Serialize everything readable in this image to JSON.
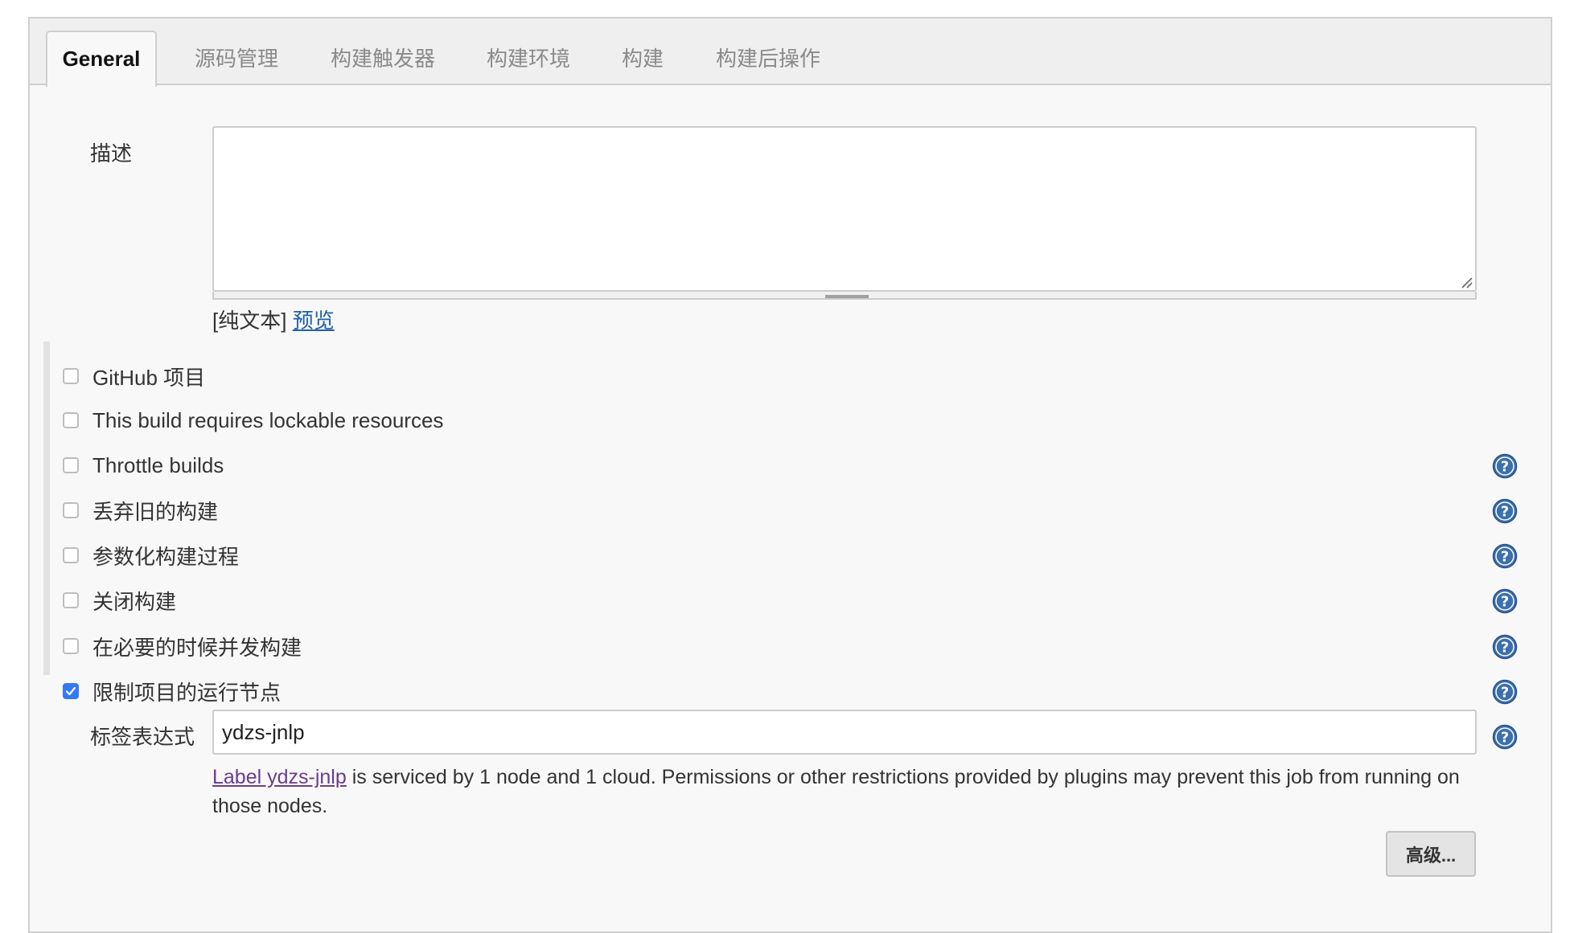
{
  "tabs": [
    "General",
    "源码管理",
    "构建触发器",
    "构建环境",
    "构建",
    "构建后操作"
  ],
  "description": {
    "label": "描述",
    "value": "",
    "format_text": "[纯文本]",
    "preview_link": "预览"
  },
  "options": [
    {
      "label": "GitHub 项目",
      "checked": false,
      "help": false
    },
    {
      "label": "This build requires lockable resources",
      "checked": false,
      "help": false
    },
    {
      "label": "Throttle builds",
      "checked": false,
      "help": true
    },
    {
      "label": "丢弃旧的构建",
      "checked": false,
      "help": true
    },
    {
      "label": "参数化构建过程",
      "checked": false,
      "help": true
    },
    {
      "label": "关闭构建",
      "checked": false,
      "help": true
    },
    {
      "label": "在必要的时候并发构建",
      "checked": false,
      "help": true
    },
    {
      "label": "限制项目的运行节点",
      "checked": true,
      "help": true
    }
  ],
  "label_expression": {
    "label": "标签表达式",
    "value": "ydzs-jnlp",
    "info_link": "Label ydzs-jnlp",
    "info_text": " is serviced by 1 node and 1 cloud. Permissions or other restrictions provided by plugins may prevent this job from running on those nodes."
  },
  "advanced_button": "高级...",
  "colors": {
    "accent": "#3478f6",
    "link": "#2061a8",
    "visited_link": "#6b3d8c",
    "help_icon": "#3b6fb0"
  },
  "icons": {
    "help": "question-mark-circle-icon",
    "check": "checkmark-icon"
  }
}
